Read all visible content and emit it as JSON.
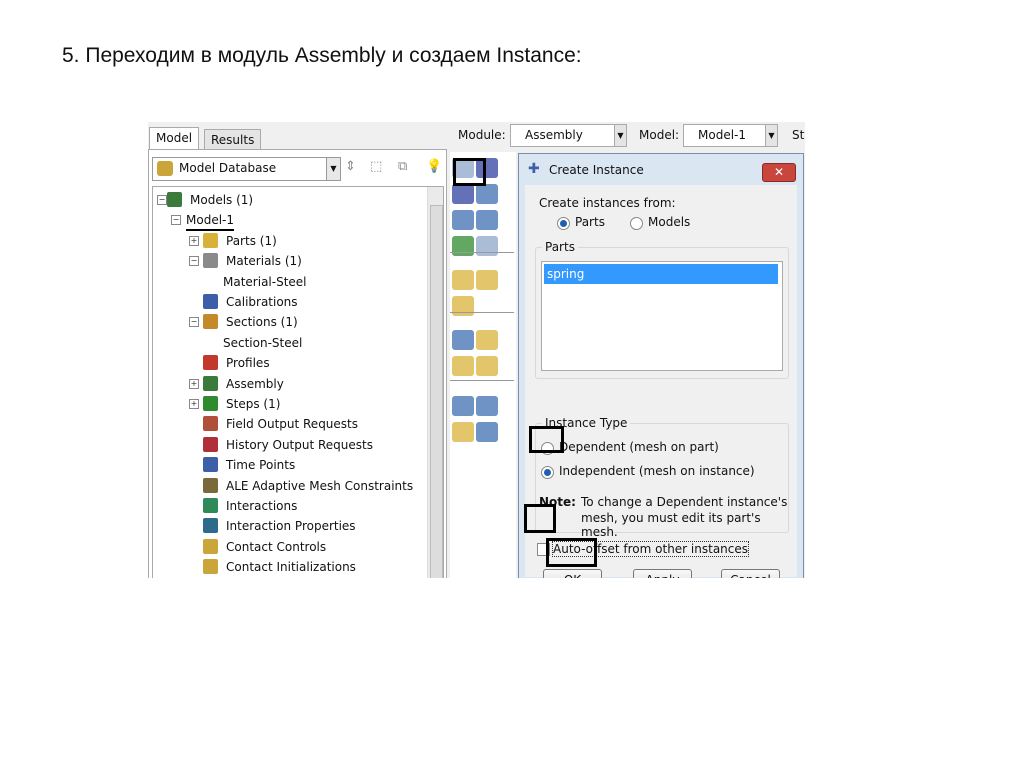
{
  "slide_title": "5. Переходим в модуль Assembly и создаем Instance:",
  "left_panel": {
    "tabs": [
      "Model",
      "Results"
    ],
    "combo_value": "Model Database",
    "tree": [
      {
        "label": "Models (1)",
        "level": 0,
        "expander": "−",
        "icon": "models-icon",
        "color": "#3a7a3a"
      },
      {
        "label": "Model-1",
        "level": 1,
        "expander": "−",
        "underline": true
      },
      {
        "label": "Parts (1)",
        "level": 2,
        "expander": "+",
        "icon": "parts-icon",
        "color": "#d9b13a"
      },
      {
        "label": "Materials (1)",
        "level": 2,
        "expander": "−",
        "icon": "materials-icon",
        "color": "#8a8a8a"
      },
      {
        "label": "Material-Steel",
        "level": 3
      },
      {
        "label": "Calibrations",
        "level": 2,
        "icon": "calibrations-icon",
        "color": "#3d5fa8"
      },
      {
        "label": "Sections (1)",
        "level": 2,
        "expander": "−",
        "icon": "sections-icon",
        "color": "#c48a2a"
      },
      {
        "label": "Section-Steel",
        "level": 3
      },
      {
        "label": "Profiles",
        "level": 2,
        "icon": "profiles-icon",
        "color": "#c0392b"
      },
      {
        "label": "Assembly",
        "level": 2,
        "expander": "+",
        "icon": "assembly-icon",
        "color": "#3a7a3a"
      },
      {
        "label": "Steps (1)",
        "level": 2,
        "expander": "+",
        "icon": "steps-icon",
        "color": "#2e8b2e"
      },
      {
        "label": "Field Output Requests",
        "level": 2,
        "icon": "field-output-icon",
        "color": "#b0503a"
      },
      {
        "label": "History Output Requests",
        "level": 2,
        "icon": "history-output-icon",
        "color": "#b0303a"
      },
      {
        "label": "Time Points",
        "level": 2,
        "icon": "time-points-icon",
        "color": "#3d5fa8"
      },
      {
        "label": "ALE Adaptive Mesh Constraints",
        "level": 2,
        "icon": "ale-icon",
        "color": "#7a6a3a"
      },
      {
        "label": "Interactions",
        "level": 2,
        "icon": "interactions-icon",
        "color": "#2e8b57"
      },
      {
        "label": "Interaction Properties",
        "level": 2,
        "icon": "interaction-properties-icon",
        "color": "#2e6b8b"
      },
      {
        "label": "Contact Controls",
        "level": 2,
        "icon": "contact-controls-icon",
        "color": "#c9a53a"
      },
      {
        "label": "Contact Initializations",
        "level": 2,
        "icon": "contact-init-icon",
        "color": "#c9a53a"
      }
    ]
  },
  "module_bar": {
    "module_label": "Module:",
    "module_value": "Assembly",
    "model_label": "Model:",
    "model_value": "Model-1",
    "step_label": "St"
  },
  "dialog": {
    "title": "Create Instance",
    "close": "✕",
    "create_from_label": "Create instances from:",
    "source_options": [
      "Parts",
      "Models"
    ],
    "source_selected": "Parts",
    "parts_group": "Parts",
    "parts_list": [
      "spring"
    ],
    "instance_type_group": "Instance Type",
    "type_options": [
      "Dependent (mesh on part)",
      "Independent (mesh on instance)"
    ],
    "type_selected": "Independent (mesh on instance)",
    "note_label": "Note:",
    "note_line1": "To change a Dependent instance's",
    "note_line2": "mesh, you must edit its part's mesh.",
    "auto_offset_label": "Auto-offset from other instances",
    "auto_offset_checked": false,
    "buttons": {
      "ok": "OK",
      "apply": "Apply",
      "cancel": "Cancel"
    }
  },
  "colors": {
    "selection": "#3399ff",
    "close": "#c9463d",
    "dialog_frame": "#dbe6f3"
  }
}
